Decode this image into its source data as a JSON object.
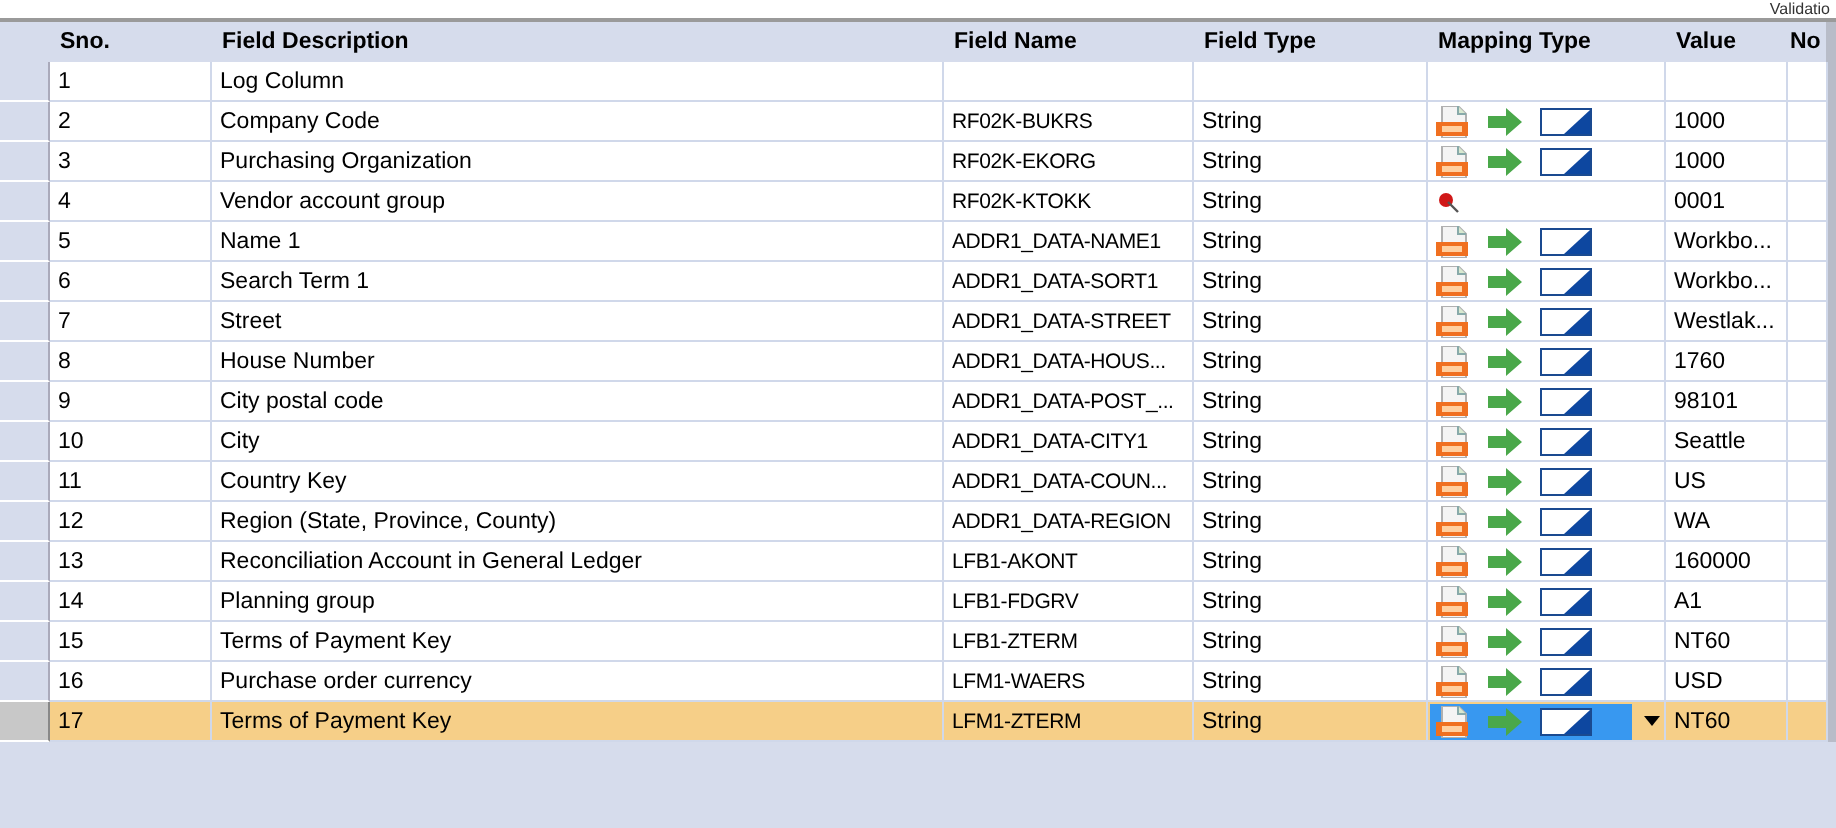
{
  "top_label": "Validatio",
  "columns": [
    "Sno.",
    "Field Description",
    "Field Name",
    "Field Type",
    "Mapping Type",
    "Value",
    "No"
  ],
  "rows": [
    {
      "sno": "1",
      "description": "Log Column",
      "field_name": "",
      "field_type": "",
      "value": "",
      "selected": false
    },
    {
      "sno": "2",
      "description": "Company Code",
      "field_name": "RF02K-BUKRS",
      "field_type": "String",
      "kind": "transfer",
      "value": "1000",
      "selected": false
    },
    {
      "sno": "3",
      "description": "Purchasing Organization",
      "field_name": "RF02K-EKORG",
      "field_type": "String",
      "kind": "transfer",
      "value": "1000",
      "selected": false
    },
    {
      "sno": "4",
      "description": "Vendor account group",
      "field_name": "RF02K-KTOKK",
      "field_type": "String",
      "kind": "pin",
      "value": "0001",
      "selected": false
    },
    {
      "sno": "5",
      "description": "Name 1",
      "field_name": "ADDR1_DATA-NAME1",
      "field_type": "String",
      "kind": "transfer",
      "value": "Workbo...",
      "selected": false
    },
    {
      "sno": "6",
      "description": "Search Term 1",
      "field_name": "ADDR1_DATA-SORT1",
      "field_type": "String",
      "kind": "transfer",
      "value": "Workbo...",
      "selected": false
    },
    {
      "sno": "7",
      "description": "Street",
      "field_name": "ADDR1_DATA-STREET",
      "field_type": "String",
      "kind": "transfer",
      "value": "Westlak...",
      "selected": false
    },
    {
      "sno": "8",
      "description": "House Number",
      "field_name": "ADDR1_DATA-HOUS...",
      "field_type": "String",
      "kind": "transfer",
      "value": "1760",
      "selected": false
    },
    {
      "sno": "9",
      "description": "City postal code",
      "field_name": "ADDR1_DATA-POST_...",
      "field_type": "String",
      "kind": "transfer",
      "value": "98101",
      "selected": false
    },
    {
      "sno": "10",
      "description": "City",
      "field_name": "ADDR1_DATA-CITY1",
      "field_type": "String",
      "kind": "transfer",
      "value": "Seattle",
      "selected": false
    },
    {
      "sno": "11",
      "description": "Country Key",
      "field_name": "ADDR1_DATA-COUN...",
      "field_type": "String",
      "kind": "transfer",
      "value": "US",
      "selected": false
    },
    {
      "sno": "12",
      "description": "Region (State, Province, County)",
      "field_name": "ADDR1_DATA-REGION",
      "field_type": "String",
      "kind": "transfer",
      "value": "WA",
      "selected": false
    },
    {
      "sno": "13",
      "description": "Reconciliation Account in General Ledger",
      "field_name": "LFB1-AKONT",
      "field_type": "String",
      "kind": "transfer",
      "value": "160000",
      "selected": false
    },
    {
      "sno": "14",
      "description": "Planning group",
      "field_name": "LFB1-FDGRV",
      "field_type": "String",
      "kind": "transfer",
      "value": "A1",
      "selected": false
    },
    {
      "sno": "15",
      "description": "Terms of Payment Key",
      "field_name": "LFB1-ZTERM",
      "field_type": "String",
      "kind": "transfer",
      "value": "NT60",
      "selected": false
    },
    {
      "sno": "16",
      "description": "Purchase order currency",
      "field_name": "LFM1-WAERS",
      "field_type": "String",
      "kind": "transfer",
      "value": "USD",
      "selected": false
    },
    {
      "sno": "17",
      "description": "Terms of Payment Key",
      "field_name": "LFM1-ZTERM",
      "field_type": "String",
      "kind": "transfer",
      "value": "NT60",
      "selected": true
    }
  ]
}
